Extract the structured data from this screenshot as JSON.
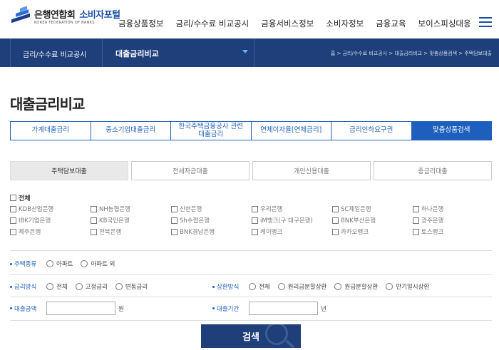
{
  "header": {
    "logo_main": "은행연합회",
    "logo_portal": "소비자포털",
    "logo_sub": "KOREA FEDERATION OF BANKS",
    "nav": [
      "금융상품정보",
      "금리/수수료 비교공시",
      "금융서비스정보",
      "소비자정보",
      "금융교육",
      "보이스피싱대응"
    ]
  },
  "subnav": {
    "category": "금리/수수료 비교공시",
    "current": "대출금리비교",
    "breadcrumb": "홈 > 금리/수수료 비교공시 > 대출금리비교 > 맞춤상품검색 > 주택담보대출"
  },
  "page_title": "대출금리비교",
  "tabs": [
    {
      "label": "가계대출금리",
      "active": false
    },
    {
      "label": "중소기업대출금리",
      "active": false
    },
    {
      "label": "한국주택금융공사 관련\n대출금리",
      "active": false
    },
    {
      "label": "연체이자율[연체금리]",
      "active": false
    },
    {
      "label": "금리인하요구권",
      "active": false
    },
    {
      "label": "맞춤상품검색",
      "active": true
    }
  ],
  "subtabs": [
    {
      "label": "주택담보대출",
      "active": true
    },
    {
      "label": "전세자금대출",
      "active": false
    },
    {
      "label": "개인신용대출",
      "active": false
    },
    {
      "label": "중금리대출",
      "active": false
    }
  ],
  "all_label": "전체",
  "banks": [
    "KDB산업은행",
    "NH농협은행",
    "신한은행",
    "우리은행",
    "SC제일은행",
    "하나은행",
    "IBK기업은행",
    "KB국민은행",
    "Sh수협은행",
    "iM뱅크(구 대구은행)",
    "BNK부산은행",
    "광주은행",
    "제주은행",
    "전북은행",
    "BNK경남은행",
    "케이뱅크",
    "카카오뱅크",
    "토스뱅크"
  ],
  "form": {
    "house_type": {
      "label": "주택종류",
      "options": [
        "아파트",
        "아파트 외"
      ]
    },
    "rate_type": {
      "label": "금리방식",
      "options": [
        "전체",
        "고정금리",
        "변동금리"
      ]
    },
    "repay_type": {
      "label": "상환방식",
      "options": [
        "전체",
        "원리금분할상환",
        "원금분할상환",
        "만기일시상환"
      ]
    },
    "amount": {
      "label": "대출금액",
      "unit": "원",
      "value": ""
    },
    "period": {
      "label": "대출기간",
      "unit": "년",
      "value": ""
    }
  },
  "search_button": "검색",
  "colors": {
    "primary": "#1e5fbd",
    "navy": "#1e3f7a"
  }
}
